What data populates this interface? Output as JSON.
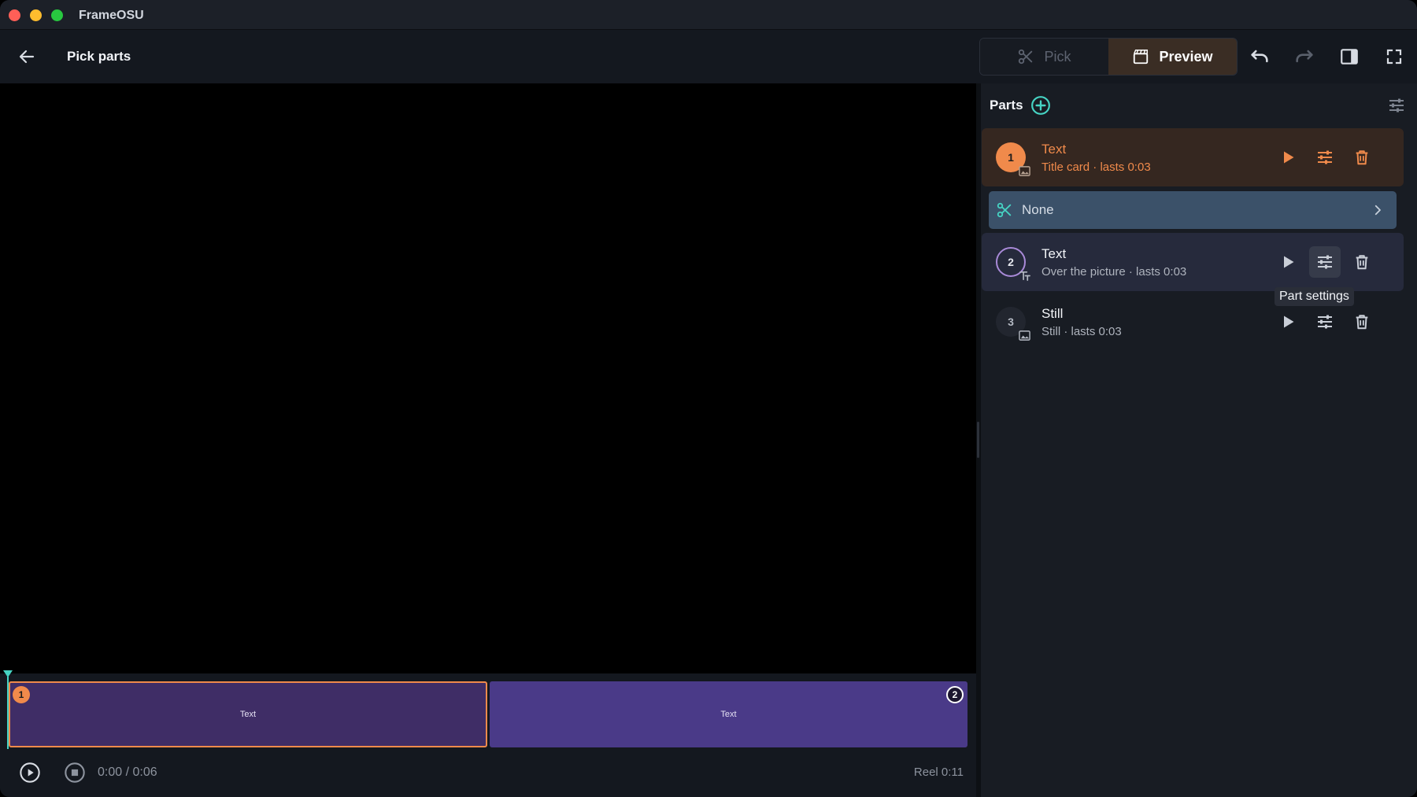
{
  "app": {
    "title": "FrameOSU"
  },
  "toolbar": {
    "page_title": "Pick parts",
    "pick_label": "Pick",
    "preview_label": "Preview"
  },
  "timeline": {
    "clips": [
      {
        "number": "1",
        "label": "Text"
      },
      {
        "number": "2",
        "label": "Text"
      }
    ],
    "time": "0:00 / 0:06",
    "reel": "Reel 0:11"
  },
  "panel": {
    "title": "Parts",
    "transition": {
      "label": "None"
    },
    "tooltip": "Part settings",
    "parts": [
      {
        "number": "1",
        "name": "Text",
        "subtitle": "Title card · lasts 0:03"
      },
      {
        "number": "2",
        "name": "Text",
        "subtitle": "Over the picture · lasts 0:03"
      },
      {
        "number": "3",
        "name": "Still",
        "subtitle": "Still · lasts 0:03"
      }
    ]
  },
  "colors": {
    "accent_orange": "#f08a4b",
    "accent_teal": "#46d3c3",
    "clip_purple": "#4a3a88",
    "transition_blue": "#3b5169"
  },
  "icons": [
    "back-arrow-icon",
    "scissors-icon",
    "clapperboard-icon",
    "undo-icon",
    "redo-icon",
    "sidebar-toggle-icon",
    "fullscreen-icon",
    "add-circle-icon",
    "sliders-icon",
    "play-icon",
    "trash-icon",
    "chevron-right-icon",
    "image-icon",
    "text-overlay-icon",
    "play-circle-icon",
    "stop-circle-icon"
  ]
}
